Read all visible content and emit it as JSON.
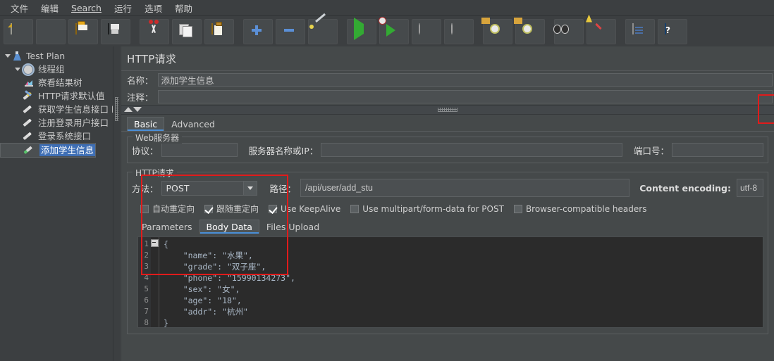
{
  "menu": {
    "items": [
      {
        "label": "文件"
      },
      {
        "label": "编辑"
      },
      {
        "label": "Search",
        "mnemonic": "S"
      },
      {
        "label": "运行"
      },
      {
        "label": "选项"
      },
      {
        "label": "帮助"
      }
    ]
  },
  "toolbar": {
    "buttons": [
      {
        "name": "new-icon",
        "title": "新建"
      },
      {
        "name": "templates-icon",
        "title": "模板"
      },
      {
        "name": "open-icon",
        "title": "打开"
      },
      {
        "name": "save-icon",
        "title": "保存"
      },
      {
        "name": "cut-icon",
        "title": "剪切"
      },
      {
        "name": "copy-icon",
        "title": "复制"
      },
      {
        "name": "paste-icon",
        "title": "粘贴"
      },
      {
        "name": "expand-icon",
        "title": "展开"
      },
      {
        "name": "collapse-icon",
        "title": "折叠"
      },
      {
        "name": "toggle-icon",
        "title": "启用/禁用"
      },
      {
        "name": "start-icon",
        "title": "启动"
      },
      {
        "name": "start-no-pause-icon",
        "title": "无间隔启动"
      },
      {
        "name": "stop-icon",
        "title": "停止"
      },
      {
        "name": "shutdown-icon",
        "title": "关闭"
      },
      {
        "name": "clear-icon",
        "title": "清除"
      },
      {
        "name": "clear-all-icon",
        "title": "清除全部"
      },
      {
        "name": "search-icon",
        "title": "搜索"
      },
      {
        "name": "reset-search-icon",
        "title": "重置搜索"
      },
      {
        "name": "log-icon",
        "title": "日志"
      },
      {
        "name": "help-icon",
        "title": "帮助"
      }
    ]
  },
  "tree": {
    "items": [
      {
        "label": "Test Plan",
        "icon": "test-plan-icon",
        "level": 0,
        "expanded": true,
        "selected": false
      },
      {
        "label": "线程组",
        "icon": "thread-group-icon",
        "level": 1,
        "expanded": true,
        "selected": false
      },
      {
        "label": "察看结果树",
        "icon": "view-results-tree-icon",
        "level": 2,
        "selected": false
      },
      {
        "label": "HTTP请求默认值",
        "icon": "http-defaults-icon",
        "level": 2,
        "selected": false
      },
      {
        "label": "获取学生信息接口 h",
        "icon": "http-sampler-icon",
        "level": 2,
        "selected": false
      },
      {
        "label": "注册登录用户接口",
        "icon": "http-sampler-icon",
        "level": 2,
        "selected": false
      },
      {
        "label": "登录系统接口",
        "icon": "http-sampler-icon",
        "level": 2,
        "selected": false
      },
      {
        "label": "添加学生信息",
        "icon": "http-sampler-icon",
        "level": 2,
        "selected": true
      }
    ]
  },
  "panel": {
    "title": "HTTP请求",
    "name_label": "名称：",
    "name_value": "添加学生信息",
    "comment_label": "注释：",
    "comment_value": "",
    "tabs": [
      {
        "label": "Basic",
        "active": true
      },
      {
        "label": "Advanced",
        "active": false
      }
    ],
    "web_server": {
      "legend": "Web服务器",
      "protocol_label": "协议：",
      "protocol_value": "",
      "server_label": "服务器名称或IP：",
      "server_value": "",
      "port_label": "端口号：",
      "port_value": ""
    },
    "http_request": {
      "legend": "HTTP请求",
      "method_label": "方法：",
      "method_value": "POST",
      "path_label": "路径：",
      "path_value": "/api/user/add_stu",
      "encoding_label": "Content encoding:",
      "encoding_value": "utf-8",
      "checkboxes": [
        {
          "label": "自动重定向",
          "checked": false
        },
        {
          "label": "跟随重定向",
          "checked": true
        },
        {
          "label": "Use KeepAlive",
          "checked": true
        },
        {
          "label": "Use multipart/form-data for POST",
          "checked": false
        },
        {
          "label": "Browser-compatible headers",
          "checked": false
        }
      ],
      "sub_tabs": [
        {
          "label": "Parameters",
          "active": false
        },
        {
          "label": "Body Data",
          "active": true
        },
        {
          "label": "Files Upload",
          "active": false
        }
      ],
      "body_lines": [
        "1",
        "2",
        "3",
        "4",
        "5",
        "6",
        "7",
        "8"
      ],
      "body_text": "{\n    \"name\": \"水果\",\n    \"grade\": \"双子座\",\n    \"phone\": \"15990134273\",\n    \"sex\": \"女\",\n    \"age\": \"18\",\n    \"addr\": \"杭州\"\n}"
    }
  },
  "annotations": {
    "encoding_highlight": "utf-8",
    "body_highlight": "body data json"
  },
  "colors": {
    "accent": "#4a8fd8",
    "selection": "#3f6fb5",
    "annotation": "#e01b1b",
    "panel_bg": "#45494a",
    "editor_bg": "#2b2b2b",
    "string_green": "#2fa32f"
  }
}
